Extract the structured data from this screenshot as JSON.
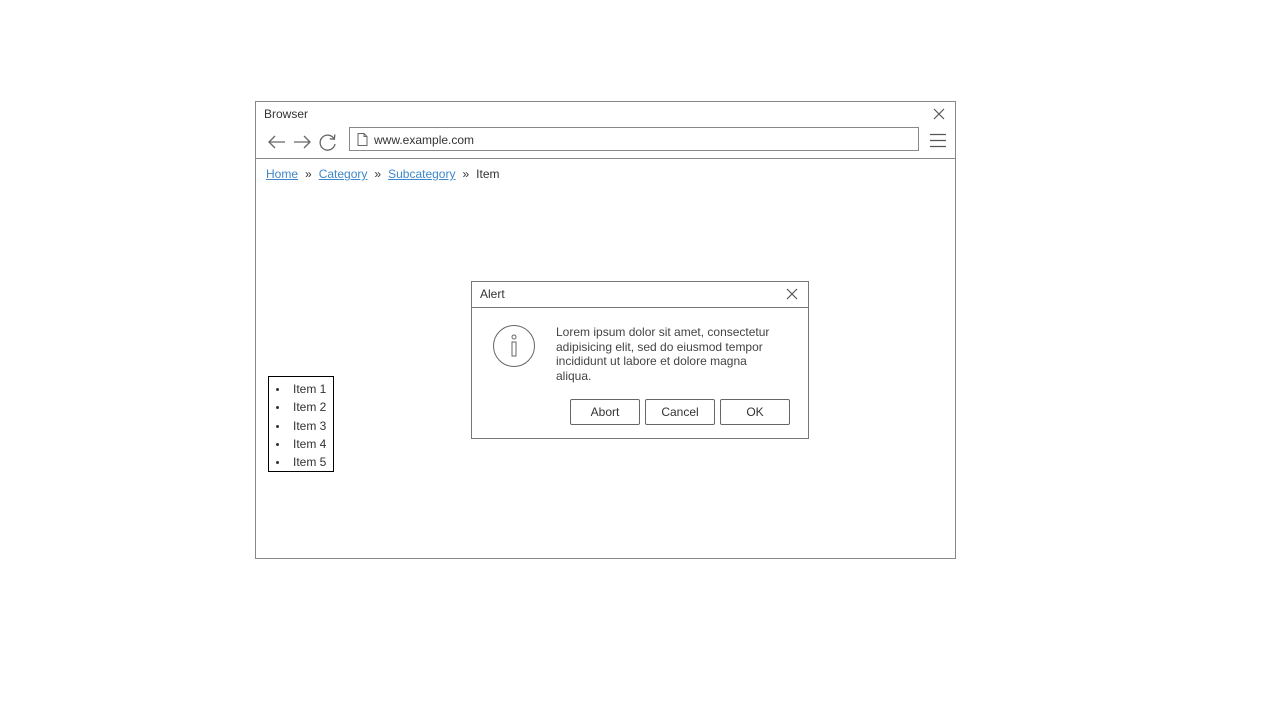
{
  "browser": {
    "title": "Browser",
    "url": "www.example.com"
  },
  "breadcrumb": {
    "items": [
      "Home",
      "Category",
      "Subcategory"
    ],
    "separator": "»",
    "current": "Item"
  },
  "list": {
    "items": [
      "Item 1",
      "Item 2",
      "Item 3",
      "Item 4",
      "Item 5"
    ]
  },
  "dialog": {
    "title": "Alert",
    "message": "Lorem ipsum dolor sit amet, consectetur adipisicing elit, sed do eiusmod tempor incididunt ut labore et dolore magna aliqua.",
    "buttons": {
      "abort": "Abort",
      "cancel": "Cancel",
      "ok": "OK"
    }
  },
  "colors": {
    "link": "#3f87c9",
    "border": "#888888",
    "text": "#333333"
  },
  "icons": {
    "browser_close": "close-icon",
    "back": "arrow-left-icon",
    "forward": "arrow-right-icon",
    "reload": "reload-icon",
    "page": "page-icon",
    "menu": "hamburger-menu-icon",
    "dialog_close": "close-icon",
    "info": "info-icon"
  }
}
